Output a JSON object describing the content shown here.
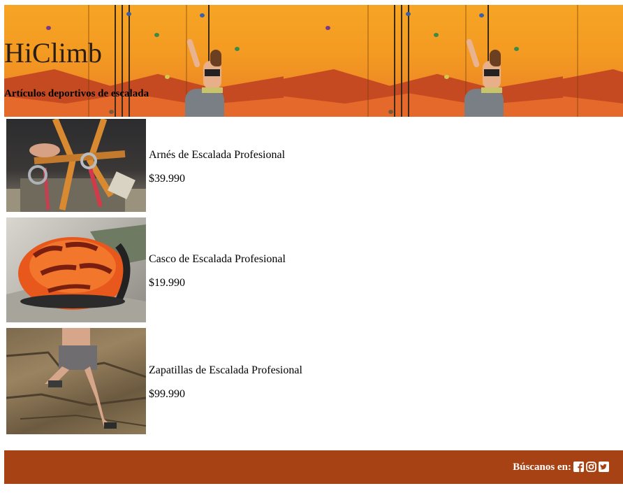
{
  "header": {
    "title": "HiClimb",
    "subtitle": "Artículos deportivos de escalada"
  },
  "products": [
    {
      "name": "Arnés de Escalada Profesional",
      "price": "$39.990",
      "image": "climbing-harness-photo"
    },
    {
      "name": "Casco de Escalada Profesional",
      "price": "$19.990",
      "image": "climbing-helmet-photo"
    },
    {
      "name": "Zapatillas de Escalada Profesional",
      "price": "$99.990",
      "image": "climbing-shoes-photo"
    }
  ],
  "footer": {
    "label": "Búscanos en:",
    "social": [
      "facebook-icon",
      "instagram-icon",
      "twitter-icon"
    ],
    "color": "#a64213"
  },
  "colors": {
    "banner_orange": "#f39a22",
    "banner_red": "#c54a22"
  }
}
